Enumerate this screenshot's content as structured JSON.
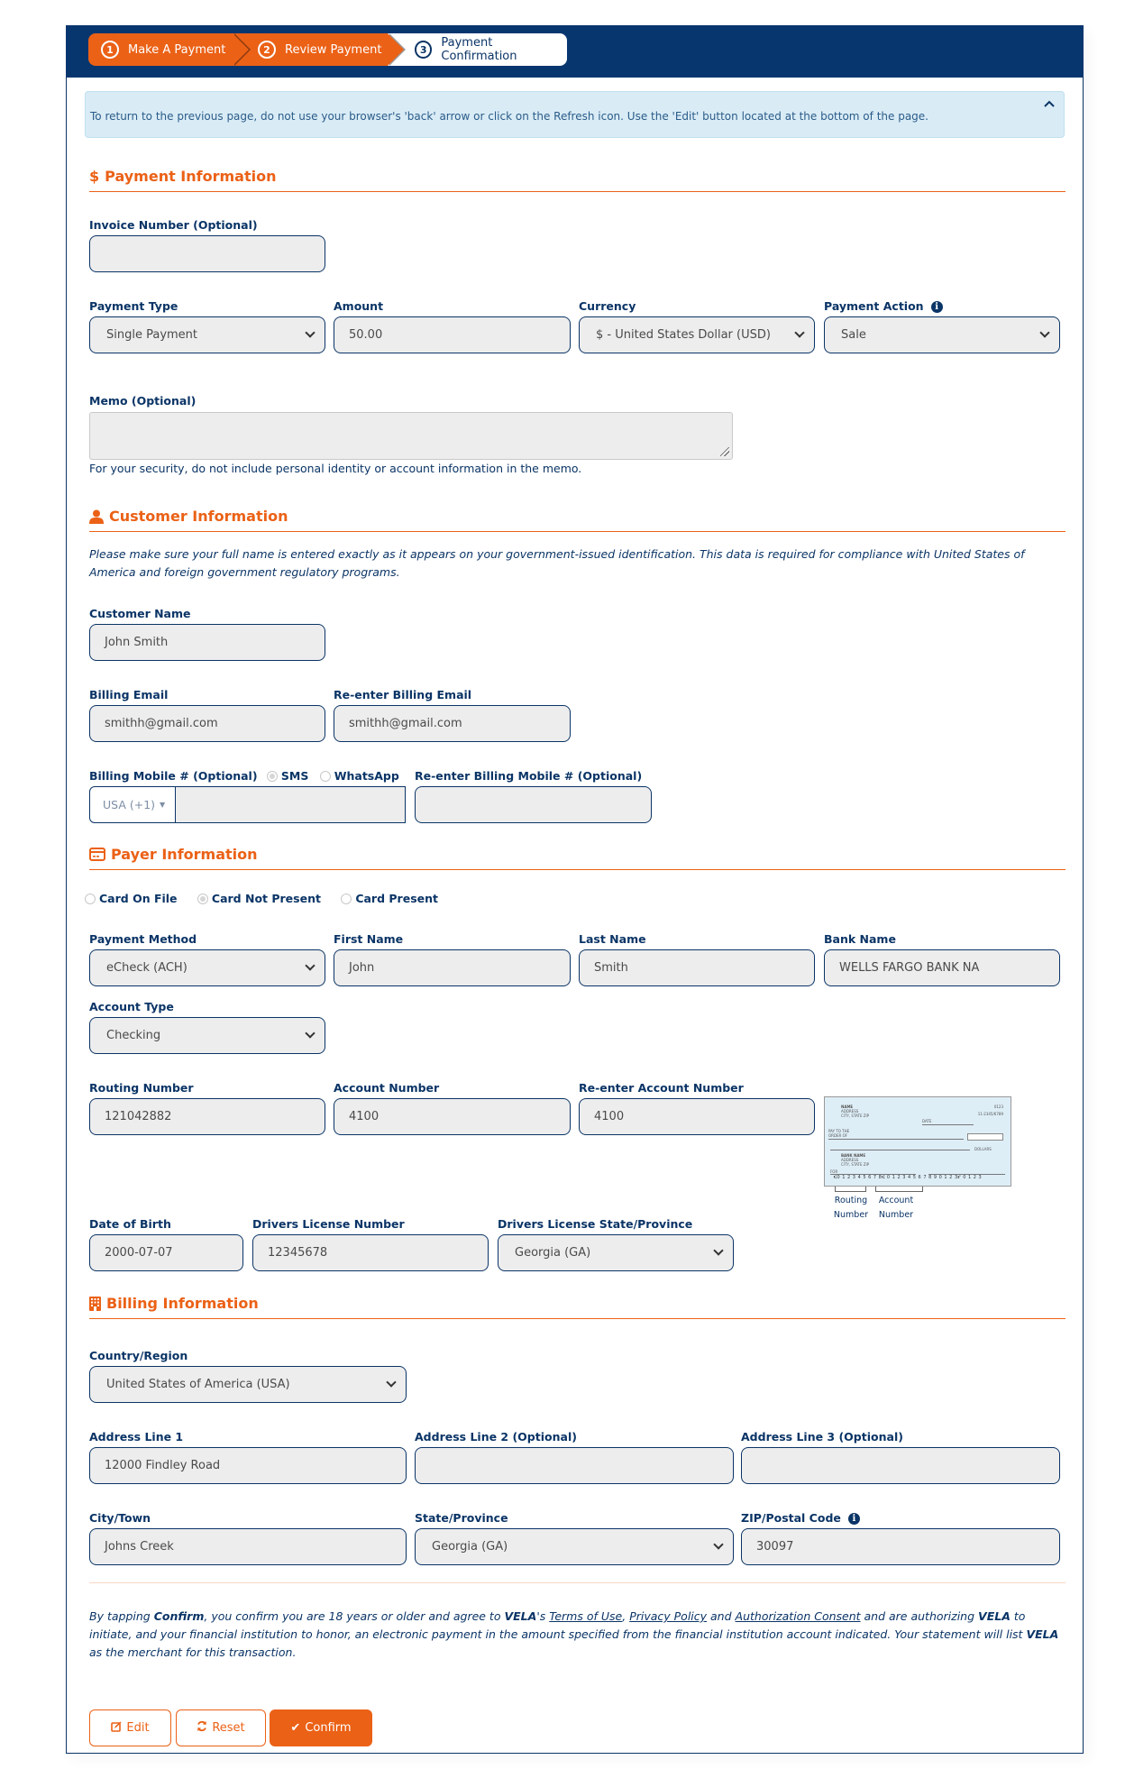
{
  "stepper": {
    "steps": [
      {
        "num": "1",
        "label": "Make A Payment",
        "state": "done"
      },
      {
        "num": "2",
        "label": "Review Payment",
        "state": "active"
      },
      {
        "num": "3",
        "label": "Payment Confirmation",
        "state": "pending"
      }
    ]
  },
  "alert": {
    "text": "To return to the previous page, do not use your browser's 'back' arrow or click on the Refresh icon. Use the 'Edit' button located at the bottom of the page.",
    "collapse_icon": "chevron-up-icon"
  },
  "payment_info": {
    "title": "Payment Information",
    "icon": "dollar-icon",
    "invoice_label": "Invoice Number (Optional)",
    "invoice_value": "",
    "payment_type_label": "Payment Type",
    "payment_type_value": "Single Payment",
    "amount_label": "Amount",
    "amount_value": "50.00",
    "currency_label": "Currency",
    "currency_value": "$ - United States Dollar (USD)",
    "payment_action_label": "Payment Action",
    "payment_action_value": "Sale",
    "memo_label": "Memo (Optional)",
    "memo_value": "",
    "memo_note": "For your security, do not include personal identity or account information in the memo."
  },
  "customer_info": {
    "title": "Customer Information",
    "icon": "user-icon",
    "notice": "Please make sure your full name is entered exactly as it appears on your government-issued identification. This data is required for compliance with United States of America and foreign government regulatory programs.",
    "name_label": "Customer Name",
    "name_value": "John Smith",
    "email_label": "Billing Email",
    "email_value": "smithh@gmail.com",
    "email2_label": "Re-enter Billing Email",
    "email2_value": "smithh@gmail.com",
    "mobile_label": "Billing Mobile # (Optional)",
    "mobile_options": [
      "SMS",
      "WhatsApp"
    ],
    "mobile_selected": "SMS",
    "mobile_country": "USA (+1)",
    "mobile_value": "",
    "mobile2_label": "Re-enter Billing Mobile # (Optional)",
    "mobile2_value": ""
  },
  "payer_info": {
    "title": "Payer Information",
    "icon": "credit-card-icon",
    "modes": [
      "Card On File",
      "Card Not Present",
      "Card Present"
    ],
    "mode_selected": "Card Not Present",
    "payment_method_label": "Payment Method",
    "payment_method_value": "eCheck (ACH)",
    "first_name_label": "First Name",
    "first_name_value": "John",
    "last_name_label": "Last Name",
    "last_name_value": "Smith",
    "bank_name_label": "Bank Name",
    "bank_name_value": "WELLS FARGO BANK NA",
    "account_type_label": "Account Type",
    "account_type_value": "Checking",
    "routing_label": "Routing Number",
    "routing_value": "121042882",
    "account_label": "Account Number",
    "account_value": "4100",
    "account2_label": "Re-enter Account Number",
    "account2_value": "4100",
    "check_image": {
      "name": "NAME",
      "address": "ADDRESS",
      "city": "CITY, STATE ZIP",
      "check_no": "0123",
      "fraction": "11-2345/6789",
      "date": "DATE",
      "pay_to": "PAY TO THE ORDER OF",
      "dollars": "DOLLARS",
      "bank_name": "BANK NAME",
      "memo": "FOR",
      "micr": "⑆0 1 2 3 4 5 6 7 8⑆  0 1 2 3 4 5 6 7 8 9 0 1 2 3⑈  0 1 2 3",
      "routing_caption": "Routing Number",
      "account_caption": "Account Number"
    },
    "dob_label": "Date of Birth",
    "dob_value": "2000-07-07",
    "dl_label": "Drivers License Number",
    "dl_value": "12345678",
    "dl_state_label": "Drivers License State/Province",
    "dl_state_value": "Georgia (GA)"
  },
  "billing_info": {
    "title": "Billing Information",
    "icon": "building-icon",
    "country_label": "Country/Region",
    "country_value": "United States of America (USA)",
    "addr1_label": "Address Line 1",
    "addr1_value": "12000 Findley Road",
    "addr2_label": "Address Line 2 (Optional)",
    "addr2_value": "",
    "addr3_label": "Address Line 3 (Optional)",
    "addr3_value": "",
    "city_label": "City/Town",
    "city_value": "Johns Creek",
    "state_label": "State/Province",
    "state_value": "Georgia (GA)",
    "zip_label": "ZIP/Postal Code",
    "zip_value": "30097"
  },
  "consent": {
    "p1": "By tapping ",
    "confirm_word": "Confirm",
    "p2": ", you confirm you are 18 years or older and agree to ",
    "merchant": "VELA",
    "p3": "'s ",
    "terms": "Terms of Use",
    "comma": ", ",
    "privacy": "Privacy Policy",
    "and": " and ",
    "auth": "Authorization Consent",
    "p4": " and are authorizing ",
    "p5": " to initiate, and your financial institution to honor, an electronic payment in the amount specified from the financial institution account indicated. Your statement will list ",
    "p6": " as the merchant for this transaction."
  },
  "actions": {
    "edit_label": "Edit",
    "reset_label": "Reset",
    "confirm_label": "Confirm"
  },
  "colors": {
    "brand_navy": "#07366f",
    "accent_orange": "#eb6116",
    "alert_bg": "#d9ecf6",
    "field_bg": "#ededed"
  }
}
